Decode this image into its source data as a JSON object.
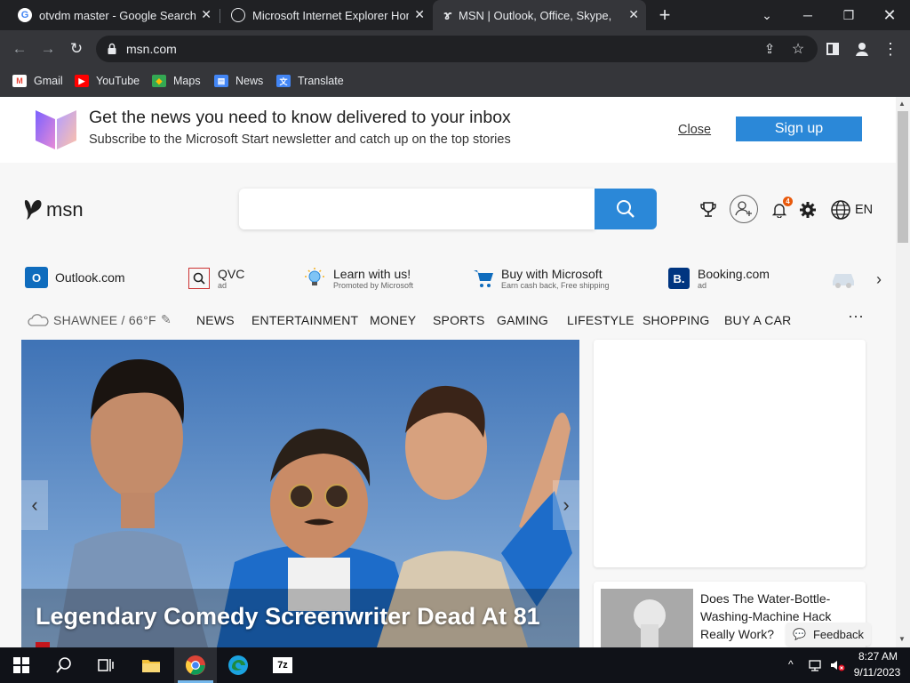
{
  "browser": {
    "tabs": [
      {
        "title": "otvdm master - Google Search",
        "icon": "google-icon"
      },
      {
        "title": "Microsoft Internet Explorer Home",
        "icon": "globe-icon"
      },
      {
        "title": "MSN | Outlook, Office, Skype, Bing",
        "icon": "msn-icon",
        "active": true
      }
    ],
    "new_tab": "+",
    "url": "msn.com",
    "bookmarks": [
      {
        "label": "Gmail",
        "icon": "gmail-icon"
      },
      {
        "label": "YouTube",
        "icon": "youtube-icon"
      },
      {
        "label": "Maps",
        "icon": "maps-icon"
      },
      {
        "label": "News",
        "icon": "news-icon"
      },
      {
        "label": "Translate",
        "icon": "translate-icon"
      }
    ]
  },
  "banner": {
    "headline": "Get the news you need to know delivered to your inbox",
    "subline": "Subscribe to the Microsoft Start newsletter and catch up on the top stories",
    "close_label": "Close",
    "signup_label": "Sign up"
  },
  "header": {
    "logo_text": "msn",
    "notification_count": "4",
    "language": "EN"
  },
  "quicklinks": [
    {
      "label": "Outlook.com",
      "sub": ""
    },
    {
      "label": "QVC",
      "sub": "ad"
    },
    {
      "label": "Learn with us!",
      "sub": "Promoted by Microsoft"
    },
    {
      "label": "Buy with Microsoft",
      "sub": "Earn cash back, Free shipping"
    },
    {
      "label": "Booking.com",
      "sub": "ad"
    }
  ],
  "weather": {
    "location": "SHAWNEE / 66°F"
  },
  "nav": [
    "NEWS",
    "ENTERTAINMENT",
    "MONEY",
    "SPORTS",
    "GAMING",
    "LIFESTYLE",
    "SHOPPING",
    "BUY A CAR"
  ],
  "hero": {
    "headline": "Legendary Comedy Screenwriter Dead At 81"
  },
  "side_story": {
    "title": "Does The Water-Bottle-Washing-Machine Hack Really Work?"
  },
  "feedback_label": "Feedback",
  "taskbar": {
    "time": "8:27 AM",
    "date": "9/11/2023"
  },
  "colors": {
    "msn_blue": "#2b88d8",
    "chrome_dark": "#202124",
    "chrome_toolbar": "#35363a"
  }
}
